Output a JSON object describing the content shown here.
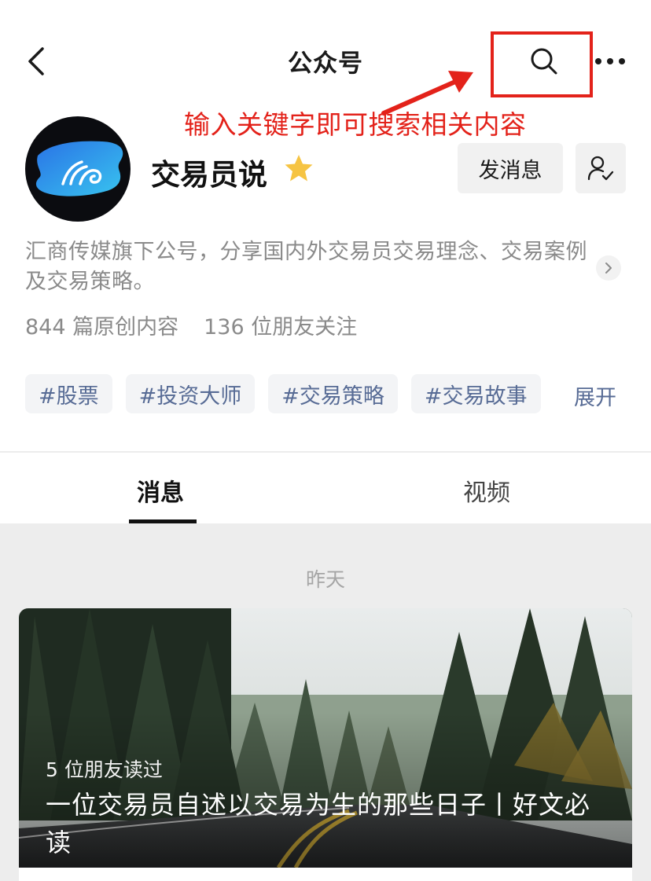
{
  "nav": {
    "title": "公众号"
  },
  "annotation": {
    "text": "输入关键字即可搜索相关内容",
    "color": "#e3221a"
  },
  "profile": {
    "name": "交易员说",
    "send_message_label": "发消息",
    "description": "汇商传媒旗下公号，分享国内外交易员交易理念、交易案例及交易策略。",
    "original_count": "844 篇原创内容",
    "followers": "136 位朋友关注",
    "tags": [
      "#股票",
      "#投资大师",
      "#交易策略",
      "#交易故事"
    ],
    "expand_label": "展开"
  },
  "tabs": [
    {
      "label": "消息",
      "active": true
    },
    {
      "label": "视频",
      "active": false
    }
  ],
  "feed": {
    "date_label": "昨天",
    "article": {
      "friends_read": "5 位朋友读过",
      "title": "一位交易员自述以交易为生的那些日子丨好文必读"
    }
  },
  "colors": {
    "link_blue": "#576b95",
    "star": "#f6c443",
    "feed_bg": "#ededed"
  },
  "icons": [
    "back-icon",
    "search-icon",
    "more-icon",
    "star-icon",
    "follow-icon",
    "chevron-right-icon"
  ]
}
